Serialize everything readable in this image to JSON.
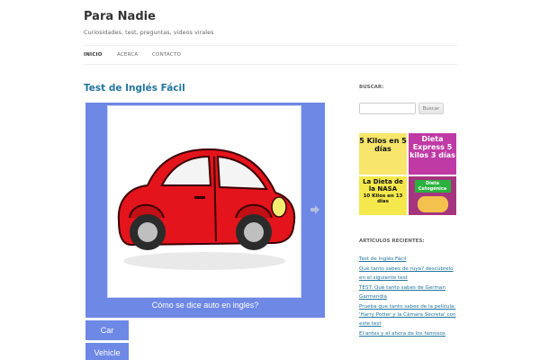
{
  "site": {
    "title": "Para Nadie",
    "tagline": "Curiosidades, test, preguntas, videos virales"
  },
  "nav": {
    "items": [
      {
        "label": "Inicio",
        "active": true
      },
      {
        "label": "Acerca",
        "active": false
      },
      {
        "label": "Contacto",
        "active": false
      }
    ]
  },
  "post": {
    "title": "Test de Inglés Fácil"
  },
  "quiz": {
    "question": "Cómo se dice auto en inglés?",
    "answers": [
      "Car",
      "Vehicle"
    ],
    "accent_color": "#6e88e6"
  },
  "sidebar": {
    "search_title": "BUSCAR:",
    "search_button": "Buscar",
    "ad": {
      "cells": [
        {
          "text": "5 Kilos en 5 días"
        },
        {
          "text": "Dieta Express 5 kilos 3 días"
        },
        {
          "text": "La Dieta de la NASA"
        },
        {
          "text": "10 Kilos en 13 días"
        },
        {
          "text": "Dieta Cetogénica"
        }
      ]
    },
    "recent_title": "ARTÍCULOS RECIENTES:",
    "recent_posts": [
      "Test de Inglés Fácil",
      "Qué tanto sabes de ruya? descúbrelo en el siguiente test",
      "TEST: Qué tanto sabes de German Garmendia",
      "Prueba que tanto sabes de la película: 'Harry Potter y la Cámara Secreta' con este test",
      "El antes y el ahora de los famosos"
    ]
  }
}
